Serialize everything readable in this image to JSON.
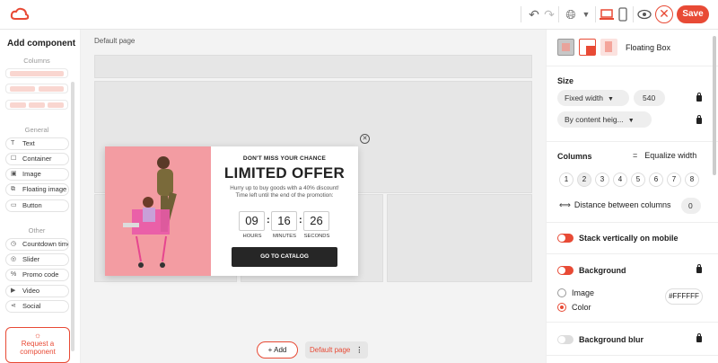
{
  "toolbar": {
    "save_label": "Save"
  },
  "left": {
    "title": "Add component",
    "columns_label": "Columns",
    "general_label": "General",
    "general_items": [
      {
        "label": "Text",
        "icon": "T"
      },
      {
        "label": "Container",
        "icon": "container-icon"
      },
      {
        "label": "Image",
        "icon": "image-icon"
      },
      {
        "label": "Floating image",
        "icon": "floating-image-icon"
      },
      {
        "label": "Button",
        "icon": "button-icon"
      }
    ],
    "other_label": "Other",
    "other_items": [
      {
        "label": "Countdown timer",
        "icon": "timer-icon"
      },
      {
        "label": "Slider",
        "icon": "slider-icon"
      },
      {
        "label": "Promo code",
        "icon": "percent-icon"
      },
      {
        "label": "Video",
        "icon": "play-icon"
      },
      {
        "label": "Social",
        "icon": "share-icon"
      }
    ],
    "request_label_1": "Request a",
    "request_label_2": "component"
  },
  "canvas": {
    "breadcrumb": "Default page",
    "add_label": "Add",
    "page_label": "Default page"
  },
  "popup": {
    "kicker": "DON'T MISS YOUR CHANCE",
    "title": "LIMITED OFFER",
    "desc_1": "Hurry up to buy goods with a 40% discount!",
    "desc_2": "Time left until the end of the promotion:",
    "hours": "09",
    "minutes": "16",
    "seconds": "26",
    "hours_label": "HOURS",
    "minutes_label": "MINUTES",
    "seconds_label": "SECONDS",
    "cta": "GO TO CATALOG"
  },
  "right": {
    "type_label": "Floating Box",
    "size_label": "Size",
    "width_mode": "Fixed width",
    "width_value": "540",
    "height_mode": "By content heig...",
    "columns_label": "Columns",
    "equalize_label": "Equalize width",
    "column_options": [
      "1",
      "2",
      "3",
      "4",
      "5",
      "6",
      "7",
      "8"
    ],
    "distance_label": "Distance between columns",
    "distance_value": "0",
    "stack_label": "Stack vertically on mobile",
    "background_label": "Background",
    "image_option": "Image",
    "color_option": "Color",
    "color_value": "#FFFFFF",
    "blur_label": "Background blur"
  },
  "colors": {
    "accent": "#e84a35"
  }
}
